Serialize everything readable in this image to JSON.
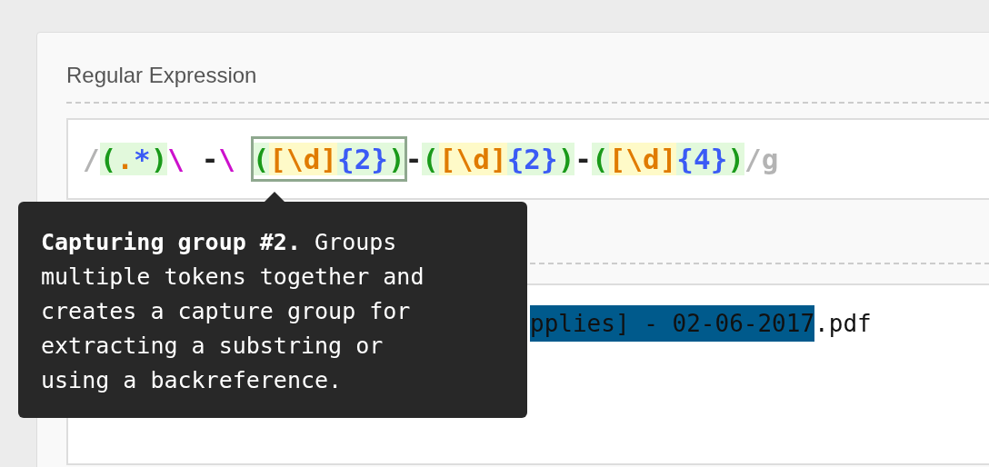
{
  "regex_section": {
    "heading": "Regular Expression",
    "parts": [
      {
        "kind": "delim",
        "text": "/"
      },
      {
        "kind": "group",
        "selected": false,
        "tokens": [
          {
            "kind": "paren",
            "text": "("
          },
          {
            "kind": "dot",
            "text": "."
          },
          {
            "kind": "quant",
            "text": "*"
          },
          {
            "kind": "paren",
            "text": ")"
          }
        ]
      },
      {
        "kind": "escape",
        "text": "\\ "
      },
      {
        "kind": "literal",
        "text": "-"
      },
      {
        "kind": "escape",
        "text": "\\ "
      },
      {
        "kind": "group",
        "selected": true,
        "tokens": [
          {
            "kind": "paren",
            "text": "("
          },
          {
            "kind": "class",
            "text": "[\\d]"
          },
          {
            "kind": "quant",
            "text": "{2}"
          },
          {
            "kind": "paren",
            "text": ")"
          }
        ]
      },
      {
        "kind": "literal",
        "text": "-"
      },
      {
        "kind": "group",
        "selected": false,
        "tokens": [
          {
            "kind": "paren",
            "text": "("
          },
          {
            "kind": "class",
            "text": "[\\d]"
          },
          {
            "kind": "quant",
            "text": "{2}"
          },
          {
            "kind": "paren",
            "text": ")"
          }
        ]
      },
      {
        "kind": "literal",
        "text": "-"
      },
      {
        "kind": "group",
        "selected": false,
        "tokens": [
          {
            "kind": "paren",
            "text": "("
          },
          {
            "kind": "class",
            "text": "[\\d]"
          },
          {
            "kind": "quant",
            "text": "{4}"
          },
          {
            "kind": "paren",
            "text": ")"
          }
        ]
      },
      {
        "kind": "delim",
        "text": "/g"
      }
    ]
  },
  "test_string": {
    "matched_text": "pplies] - 02-06-2017",
    "rest_text": ".pdf"
  },
  "tooltip": {
    "text": "**Capturing group #2.** Groups multiple tokens together and creates a capture group for extracting a substring or using a backreference."
  }
}
